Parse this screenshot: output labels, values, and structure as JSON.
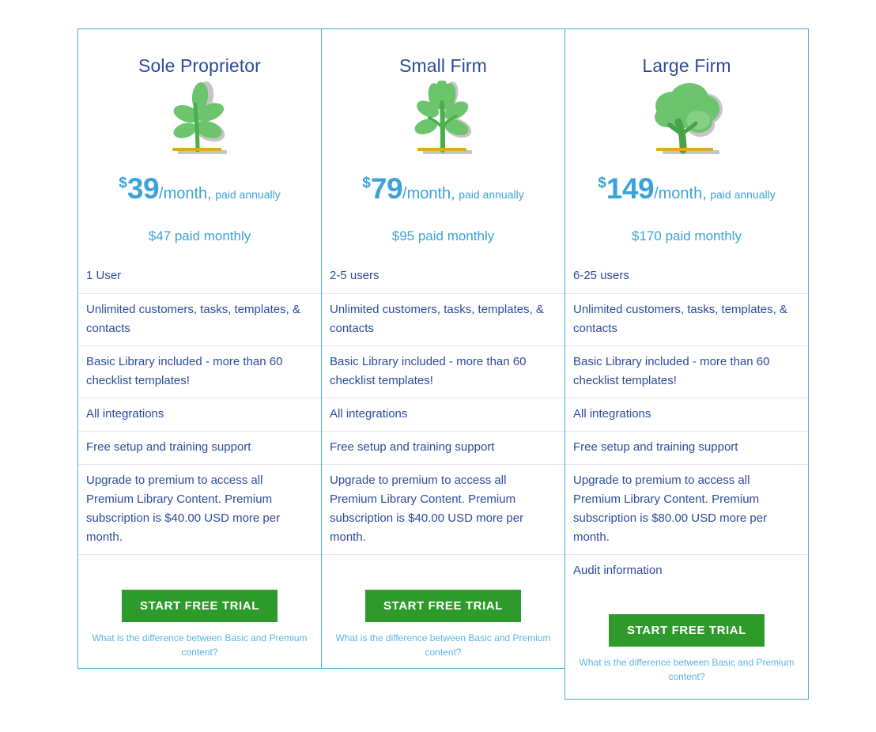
{
  "theme": {
    "card_border": "#4fa8d8",
    "row_divider": "#e3e6e8",
    "title_color": "#2b4b9b",
    "price_color": "#3ba3da",
    "feature_text_color": "#2b4b9b",
    "button_green": "#2e9a2b",
    "link_blue": "#5bb4de",
    "background": "#ffffff"
  },
  "plans": [
    {
      "title": "Sole Proprietor",
      "icon": "sapling-icon",
      "currency": "$",
      "amount": "39",
      "period": "/month,",
      "annual_note": "paid annually",
      "monthly_price": "$47 paid monthly",
      "users": "1 User",
      "features": [
        "Unlimited customers, tasks, templates, & contacts",
        "Basic Library included - more than 60 checklist templates!",
        "All integrations",
        "Free setup and training support",
        "Upgrade to premium to access all Premium Library Content. Premium subscription is $40.00 USD more per month."
      ],
      "audit": null,
      "cta_label": "START FREE TRIAL",
      "premium_link": "What is the difference between Basic and Premium content?"
    },
    {
      "title": "Small Firm",
      "icon": "plant-icon",
      "currency": "$",
      "amount": "79",
      "period": "/month,",
      "annual_note": "paid annually",
      "monthly_price": "$95 paid monthly",
      "users": "2-5 users",
      "features": [
        "Unlimited customers, tasks, templates, & contacts",
        "Basic Library included - more than 60 checklist templates!",
        "All integrations",
        "Free setup and training support",
        "Upgrade to premium to access all Premium Library Content. Premium subscription is $40.00 USD more per month."
      ],
      "audit": null,
      "cta_label": "START FREE TRIAL",
      "premium_link": "What is the difference between Basic and Premium content?"
    },
    {
      "title": "Large Firm",
      "icon": "tree-icon",
      "currency": "$",
      "amount": "149",
      "period": "/month,",
      "annual_note": "paid annually",
      "monthly_price": "$170 paid monthly",
      "users": "6-25 users",
      "features": [
        "Unlimited customers, tasks, templates, & contacts",
        "Basic Library included - more than 60 checklist templates!",
        "All integrations",
        "Free setup and training support",
        "Upgrade to premium to access all Premium Library Content. Premium subscription is $80.00 USD more per month."
      ],
      "audit": "Audit information",
      "cta_label": "START FREE TRIAL",
      "premium_link": "What is the difference between Basic and Premium content?"
    }
  ]
}
